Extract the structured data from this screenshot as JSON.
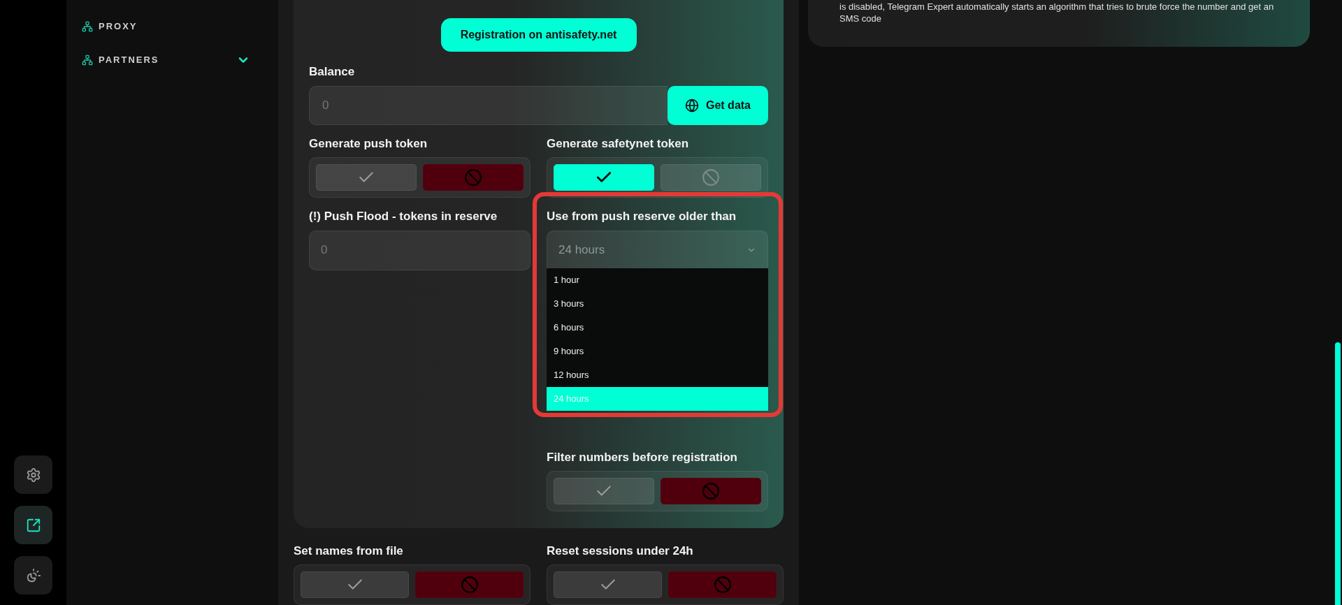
{
  "rail": [
    {
      "kind": "settings",
      "selected": false
    },
    {
      "kind": "export",
      "selected": true
    },
    {
      "kind": "theme",
      "selected": false
    }
  ],
  "sidebar": {
    "items": [
      {
        "label": "PROXY",
        "kind": "link"
      },
      {
        "label": "PARTNERS",
        "kind": "group"
      }
    ]
  },
  "form": {
    "register_button": "Registration on antisafety.net",
    "balance": {
      "label": "Balance",
      "placeholder": "0",
      "button": "Get data"
    },
    "push_token": {
      "label": "Generate push token",
      "on": false
    },
    "safetynet_token": {
      "label": "Generate safetynet token",
      "on": true
    },
    "push_flood": {
      "label": "(!) Push Flood - tokens in reserve",
      "placeholder": "0"
    },
    "reserve_age": {
      "label": "Use from push reserve older than",
      "value": "24 hours",
      "highlighted": true,
      "options": [
        {
          "label": "1 hour",
          "selected": false
        },
        {
          "label": "3 hours",
          "selected": false
        },
        {
          "label": "6 hours",
          "selected": false
        },
        {
          "label": "9 hours",
          "selected": false
        },
        {
          "label": "12 hours",
          "selected": false
        },
        {
          "label": "24 hours",
          "selected": true
        }
      ]
    },
    "filter_numbers": {
      "label": "Filter numbers before registration",
      "on": false
    }
  },
  "bottom_toggles": [
    {
      "label": "Set names from file",
      "on": false
    },
    {
      "label": "Reset sessions under 24h",
      "on": false
    }
  ],
  "info_panel": {
    "text": "is disabled, Telegram Expert automatically starts an algorithm that tries to brute force the number and get an SMS code"
  }
}
